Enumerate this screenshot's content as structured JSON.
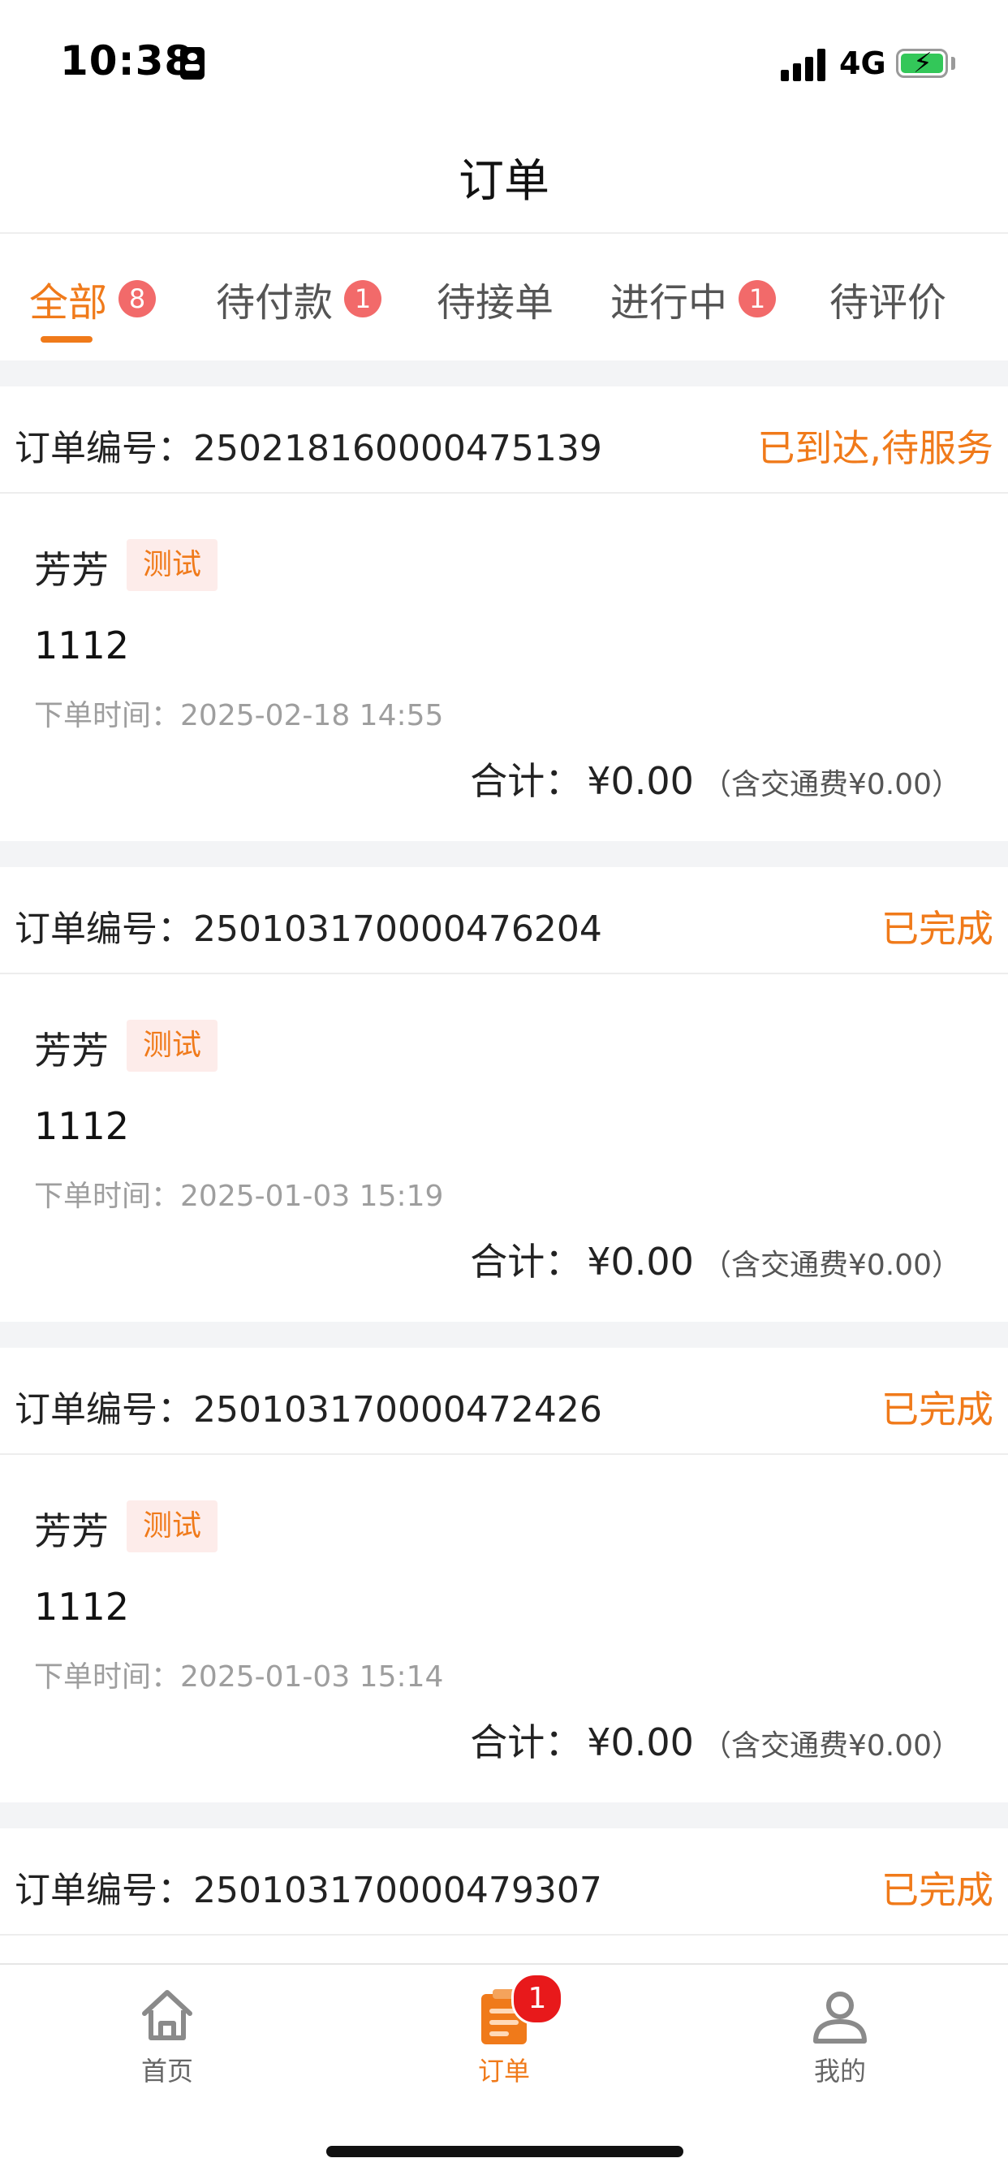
{
  "status_bar": {
    "time": "10:38",
    "network": "4G"
  },
  "header": {
    "title": "订单"
  },
  "tabs": [
    {
      "label": "全部",
      "badge": "8",
      "active": true
    },
    {
      "label": "待付款",
      "badge": "1"
    },
    {
      "label": "待接单",
      "badge": ""
    },
    {
      "label": "进行中",
      "badge": "1"
    },
    {
      "label": "待评价",
      "badge": ""
    }
  ],
  "orders": [
    {
      "order_no_label": "订单编号：",
      "order_no": "250218160000475139",
      "status": "已到达,待服务",
      "customer": "芳芳",
      "tag": "测试",
      "service": "1112",
      "time_label": "下单时间：",
      "time": "2025-02-18 14:55",
      "total_label": "合计：",
      "total": "¥0.00",
      "fee_note": "（含交通费¥0.00）"
    },
    {
      "order_no_label": "订单编号：",
      "order_no": "250103170000476204",
      "status": "已完成",
      "customer": "芳芳",
      "tag": "测试",
      "service": "1112",
      "time_label": "下单时间：",
      "time": "2025-01-03 15:19",
      "total_label": "合计：",
      "total": "¥0.00",
      "fee_note": "（含交通费¥0.00）"
    },
    {
      "order_no_label": "订单编号：",
      "order_no": "250103170000472426",
      "status": "已完成",
      "customer": "芳芳",
      "tag": "测试",
      "service": "1112",
      "time_label": "下单时间：",
      "time": "2025-01-03 15:14",
      "total_label": "合计：",
      "total": "¥0.00",
      "fee_note": "（含交通费¥0.00）"
    },
    {
      "order_no_label": "订单编号：",
      "order_no": "250103170000479307",
      "status": "已完成"
    }
  ],
  "bottom_nav": [
    {
      "label": "首页",
      "icon": "home-icon",
      "active": false
    },
    {
      "label": "订单",
      "icon": "orders-icon",
      "active": true,
      "badge": "1"
    },
    {
      "label": "我的",
      "icon": "profile-icon",
      "active": false
    }
  ],
  "colors": {
    "accent": "#f07a1a",
    "badge": "#f26a6a",
    "tag_bg": "#fdecea",
    "nav_badge": "#e8191b"
  }
}
